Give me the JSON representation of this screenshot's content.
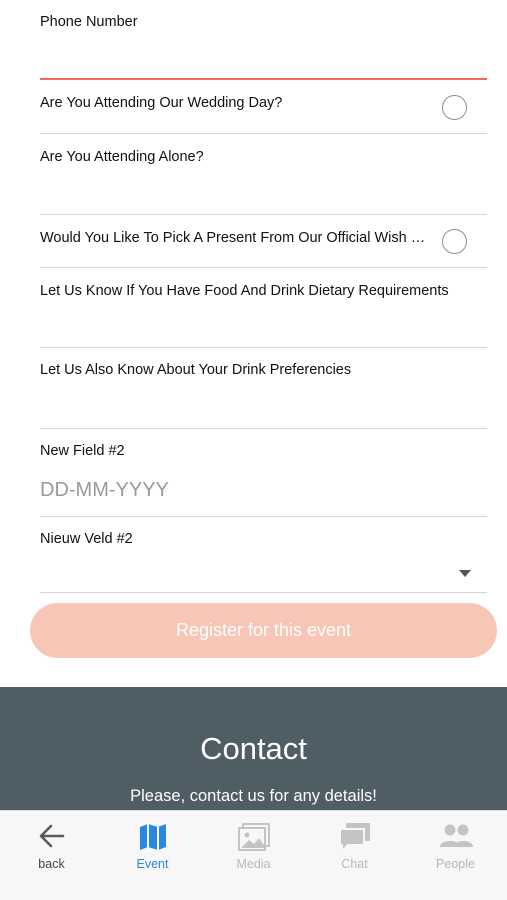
{
  "form": {
    "phone_label": "Phone Number",
    "attending_wedding_label": "Are You Attending Our Wedding Day?",
    "attending_alone_label": "Are You Attending Alone?",
    "wish_list_label": "Would You Like To Pick A Present From Our Official Wish List?",
    "dietary_label": "Let Us Know If You Have Food And Drink Dietary Requirements",
    "drink_pref_label": "Let Us Also Know About Your Drink Preferencies",
    "new_field_label": "New Field #2",
    "new_field_placeholder": "DD-MM-YYYY",
    "nieuw_veld_label": "Nieuw Veld #2",
    "register_label": "Register for this event"
  },
  "contact": {
    "title": "Contact",
    "subtitle": "Please, contact us for any details!"
  },
  "tabbar": {
    "items": [
      {
        "label": "back",
        "icon": "arrow-left-icon"
      },
      {
        "label": "Event",
        "icon": "map-icon"
      },
      {
        "label": "Media",
        "icon": "image-icon"
      },
      {
        "label": "Chat",
        "icon": "chat-icon"
      },
      {
        "label": "People",
        "icon": "people-icon"
      }
    ],
    "active_color": "#2a86e0",
    "inactive_color": "#b8b8b8"
  },
  "colors": {
    "accent": "#ef6b5f",
    "register_button": "#f8c6b6",
    "contact_bg": "#4f5d65"
  }
}
